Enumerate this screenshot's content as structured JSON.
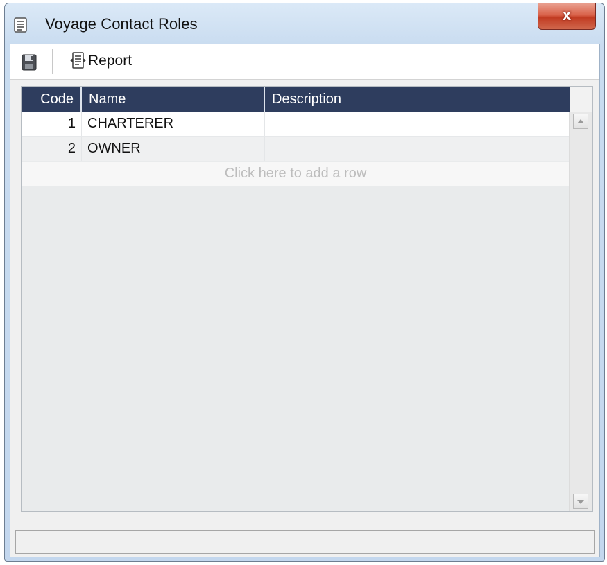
{
  "window": {
    "title": "Voyage Contact Roles",
    "close_label": "x"
  },
  "toolbar": {
    "save_icon": "floppy-disk-icon",
    "report_icon": "report-document-icon",
    "report_label": "Report"
  },
  "grid": {
    "columns": [
      "Code",
      "Name",
      "Description"
    ],
    "rows": [
      {
        "code": "1",
        "name": "CHARTERER",
        "description": ""
      },
      {
        "code": "2",
        "name": "OWNER",
        "description": ""
      }
    ],
    "add_row_text": "Click here to add a row"
  },
  "colors": {
    "header_bg": "#2e3d5e",
    "close_button": "#c13b22",
    "window_frame": "#c9dcf0"
  }
}
